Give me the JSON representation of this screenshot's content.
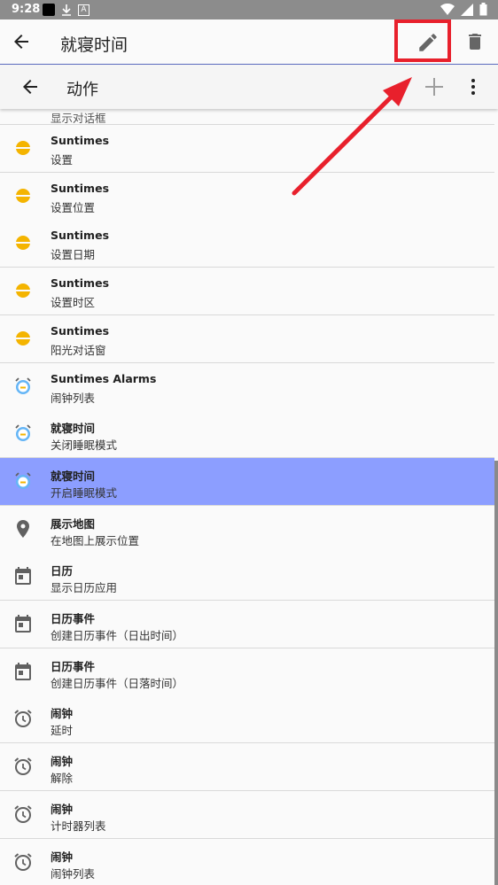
{
  "status_bar": {
    "time": "9:28",
    "a_label": "A"
  },
  "app_bar": {
    "title": "就寝时间",
    "back_icon": "arrow-left-icon",
    "edit_icon": "pencil-icon",
    "delete_icon": "trash-icon"
  },
  "sub_bar": {
    "title": "动作",
    "back_icon": "arrow-left-icon",
    "add_icon": "plus-icon",
    "more_icon": "more-vert-icon"
  },
  "list": {
    "partial_top_subtitle": "显示对话框",
    "items": [
      {
        "title": "Suntimes",
        "subtitle": "设置",
        "icon": "sun-icon"
      },
      {
        "title": "Suntimes",
        "subtitle": "设置位置",
        "icon": "sun-icon"
      },
      {
        "title": "Suntimes",
        "subtitle": "设置日期",
        "icon": "sun-icon"
      },
      {
        "title": "Suntimes",
        "subtitle": "设置时区",
        "icon": "sun-icon"
      },
      {
        "title": "Suntimes",
        "subtitle": "阳光对话窗",
        "icon": "sun-icon"
      },
      {
        "title": "Suntimes Alarms",
        "subtitle": "闹钟列表",
        "icon": "alarm-app-icon"
      },
      {
        "title": "就寝时间",
        "subtitle": "关闭睡眠模式",
        "icon": "alarm-app-icon"
      },
      {
        "title": "就寝时间",
        "subtitle": "开启睡眠模式",
        "icon": "alarm-app-icon",
        "selected": true
      },
      {
        "title": "展示地图",
        "subtitle": "在地图上展示位置",
        "icon": "location-pin-icon"
      },
      {
        "title": "日历",
        "subtitle": "显示日历应用",
        "icon": "calendar-icon"
      },
      {
        "title": "日历事件",
        "subtitle": "创建日历事件（日出时间）",
        "icon": "calendar-icon"
      },
      {
        "title": "日历事件",
        "subtitle": "创建日历事件（日落时间）",
        "icon": "calendar-icon"
      },
      {
        "title": "闹钟",
        "subtitle": "延时",
        "icon": "alarm-clock-icon"
      },
      {
        "title": "闹钟",
        "subtitle": "解除",
        "icon": "alarm-clock-icon"
      },
      {
        "title": "闹钟",
        "subtitle": "计时器列表",
        "icon": "alarm-clock-icon"
      },
      {
        "title": "闹钟",
        "subtitle": "闹钟列表",
        "icon": "alarm-clock-icon"
      }
    ]
  },
  "colors": {
    "selected_row": "#8c9eff",
    "annotation_red": "#e8202c",
    "accent_line": "#5c6bc0",
    "sun_yellow": "#f4b400"
  }
}
